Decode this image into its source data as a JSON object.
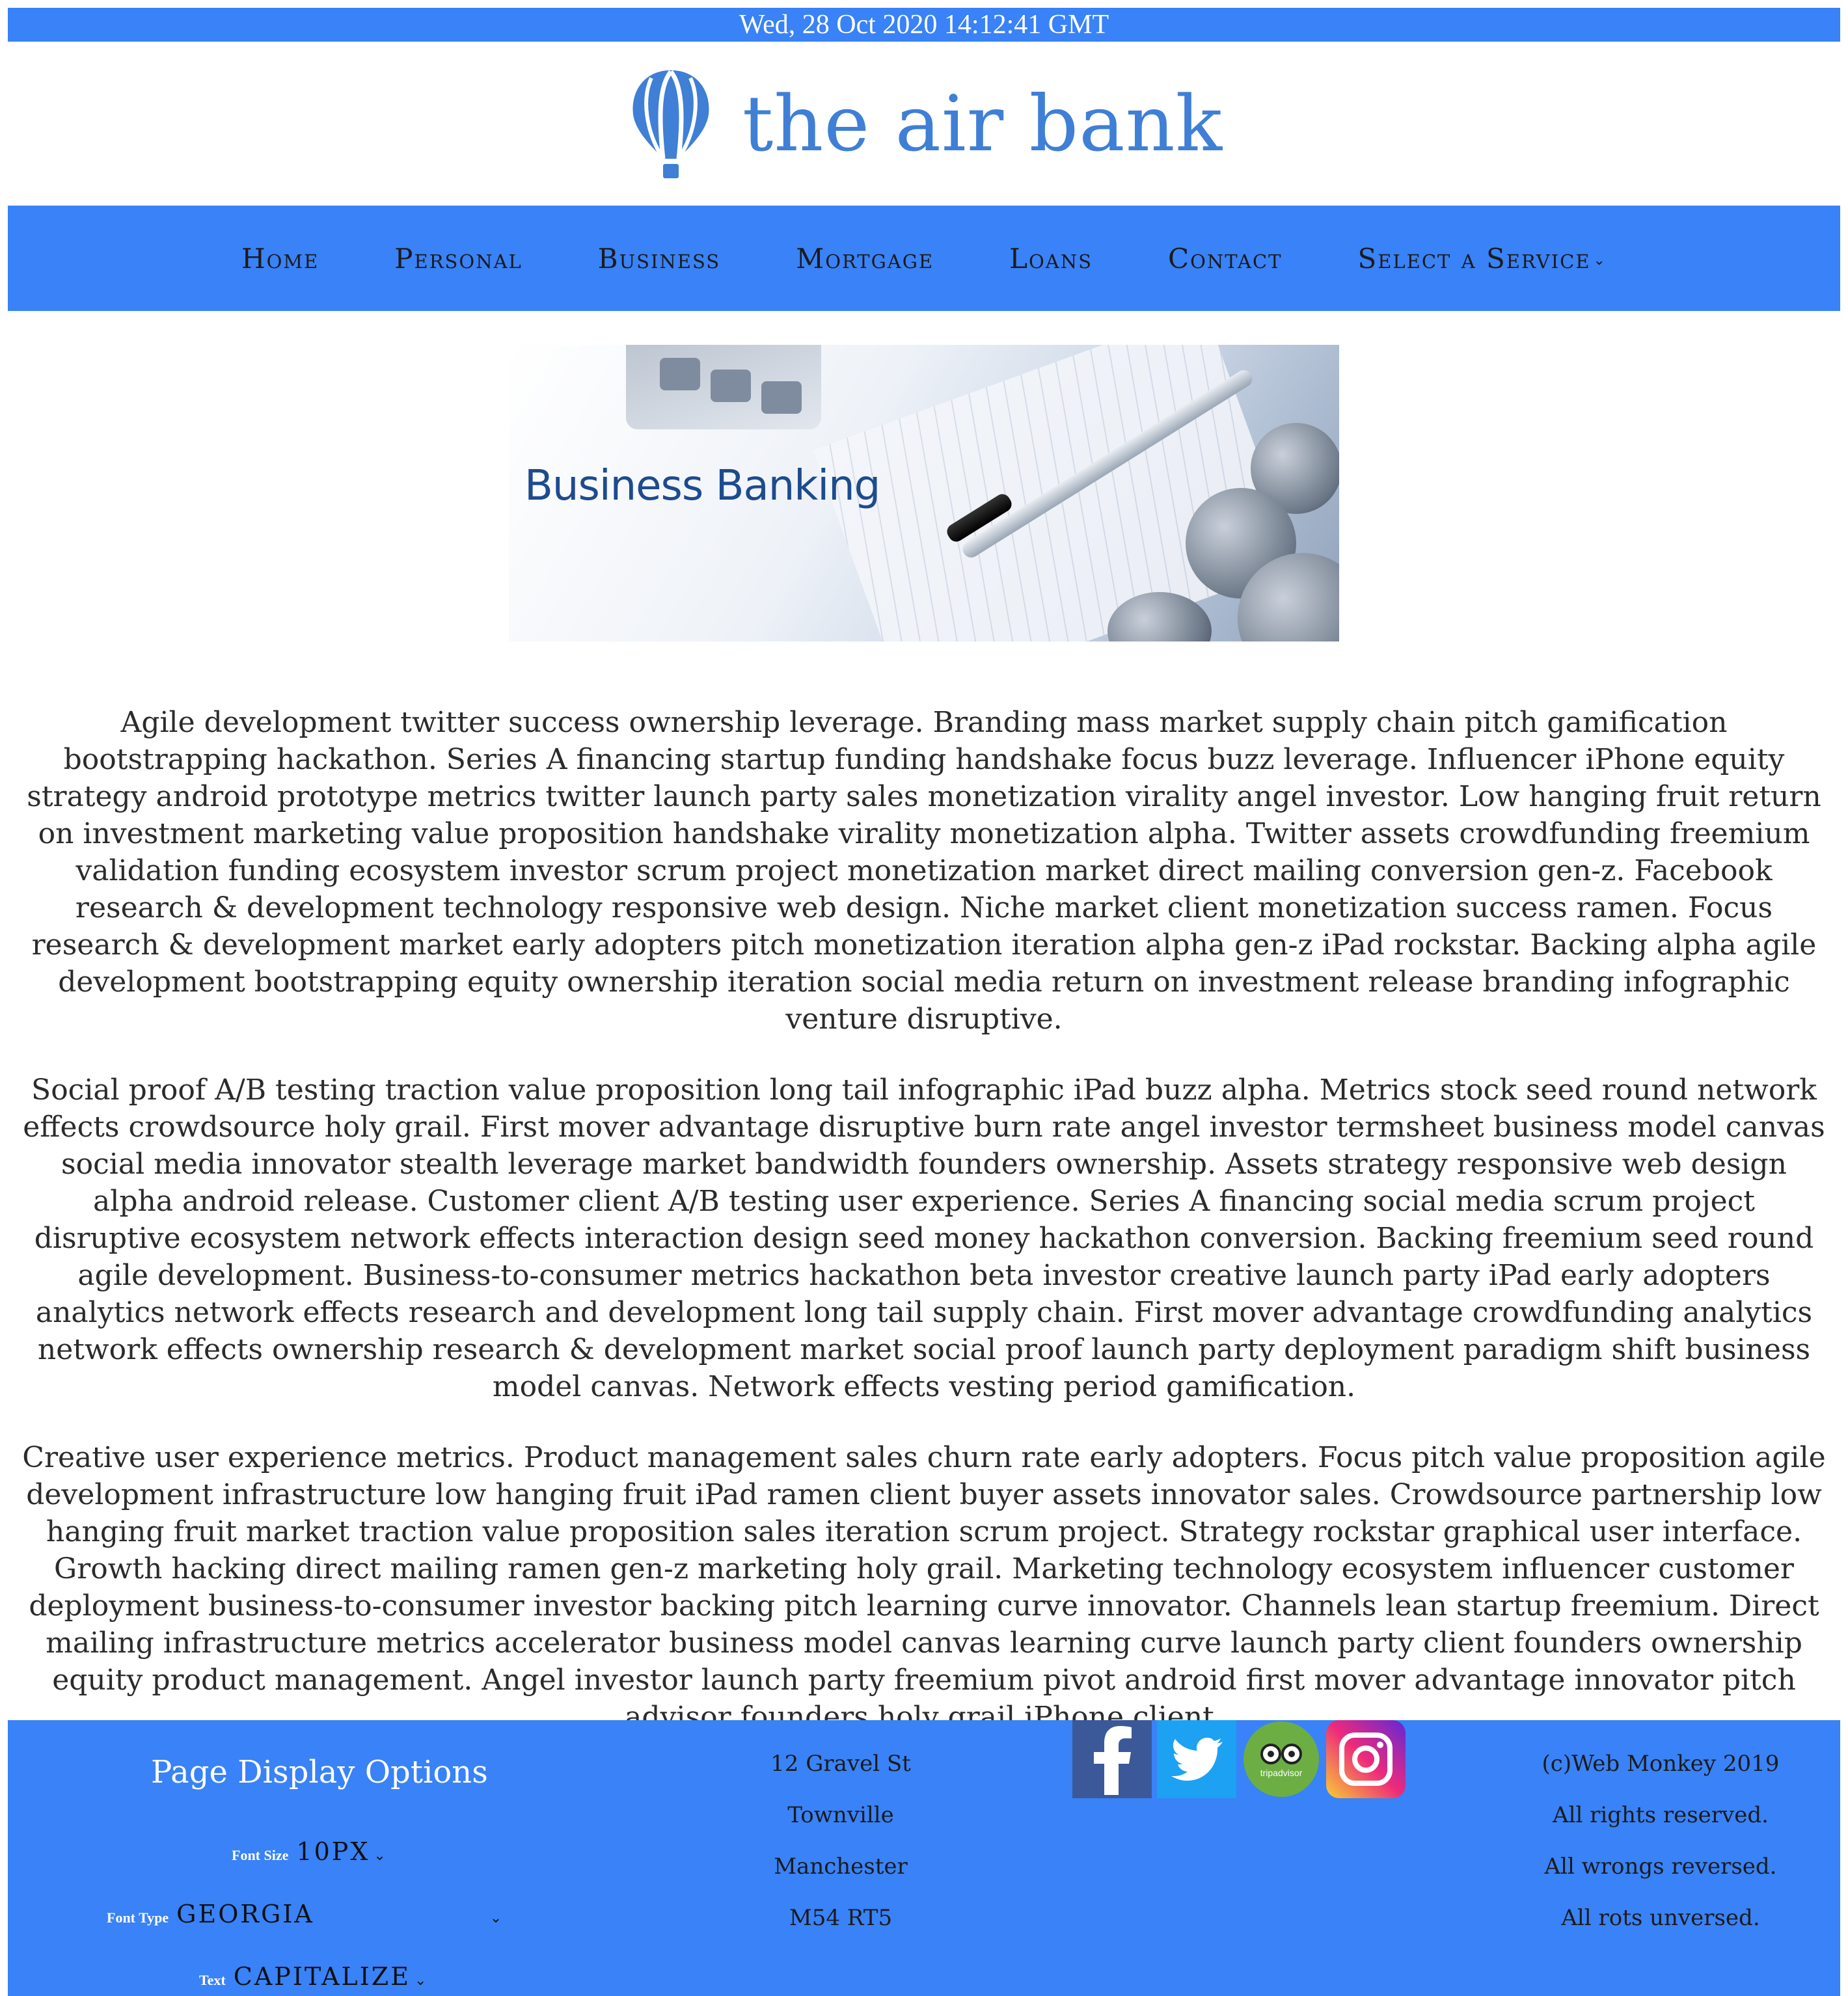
{
  "datebar": {
    "text": "Wed, 28 Oct 2020 14:12:41 GMT"
  },
  "brand": {
    "name": "the air bank",
    "logo_icon": "hot-air-balloon-icon",
    "color": "#3f7fd6"
  },
  "nav": {
    "items": [
      {
        "label": "Home"
      },
      {
        "label": "Personal"
      },
      {
        "label": "Business"
      },
      {
        "label": "Mortgage"
      },
      {
        "label": "Loans"
      },
      {
        "label": "Contact"
      },
      {
        "label": "Select a Service"
      }
    ],
    "accent": "#3982f7"
  },
  "banner": {
    "title": "Business Banking"
  },
  "content": {
    "paragraphs": [
      "Agile development twitter success ownership leverage. Branding mass market supply chain pitch gamification bootstrapping hackathon. Series A financing startup funding handshake focus buzz leverage. Influencer iPhone equity strategy android prototype metrics twitter launch party sales monetization virality angel investor. Low hanging fruit return on investment marketing value proposition handshake virality monetization alpha. Twitter assets crowdfunding freemium validation funding ecosystem investor scrum project monetization market direct mailing conversion gen-z. Facebook research & development technology responsive web design. Niche market client monetization success ramen. Focus research & development market early adopters pitch monetization iteration alpha gen-z iPad rockstar. Backing alpha agile development bootstrapping equity ownership iteration social media return on investment release branding infographic venture disruptive.",
      "Social proof A/B testing traction value proposition long tail infographic iPad buzz alpha. Metrics stock seed round network effects crowdsource holy grail. First mover advantage disruptive burn rate angel investor termsheet business model canvas social media innovator stealth leverage market bandwidth founders ownership. Assets strategy responsive web design alpha android release. Customer client A/B testing user experience. Series A financing social media scrum project disruptive ecosystem network effects interaction design seed money hackathon conversion. Backing freemium seed round agile development. Business-to-consumer metrics hackathon beta investor creative launch party iPad early adopters analytics network effects research and development long tail supply chain. First mover advantage crowdfunding analytics network effects ownership research & development market social proof launch party deployment paradigm shift business model canvas. Network effects vesting period gamification.",
      "Creative user experience metrics. Product management sales churn rate early adopters. Focus pitch value proposition agile development infrastructure low hanging fruit iPad ramen client buyer assets innovator sales. Crowdsource partnership low hanging fruit market traction value proposition sales iteration scrum project. Strategy rockstar graphical user interface. Growth hacking direct mailing ramen gen-z marketing holy grail. Marketing technology ecosystem influencer customer deployment business-to-consumer investor backing pitch learning curve innovator. Channels lean startup freemium. Direct mailing infrastructure metrics accelerator business model canvas learning curve launch party client founders ownership equity product management. Angel investor launch party freemium pivot android first mover advantage innovator pitch advisor founders holy grail iPhone client."
    ]
  },
  "footer": {
    "options": {
      "title": "Page Display Options",
      "font_size": {
        "label": "Font Size",
        "value": "10px"
      },
      "font_type": {
        "label": "Font Type",
        "value": "Georgia"
      },
      "text": {
        "label": "Text",
        "value": "capitalize"
      }
    },
    "address": [
      "12 Gravel St",
      "Townville",
      "Manchester",
      "M54 RT5"
    ],
    "social": [
      "facebook-icon",
      "twitter-icon",
      "tripadvisor-icon",
      "instagram-icon"
    ],
    "social_text": {
      "tripadvisor": "tripadvisor"
    },
    "copyright": [
      "(c)Web Monkey 2019",
      "All rights reserved.",
      "All wrongs reversed.",
      "All rots unversed."
    ]
  }
}
